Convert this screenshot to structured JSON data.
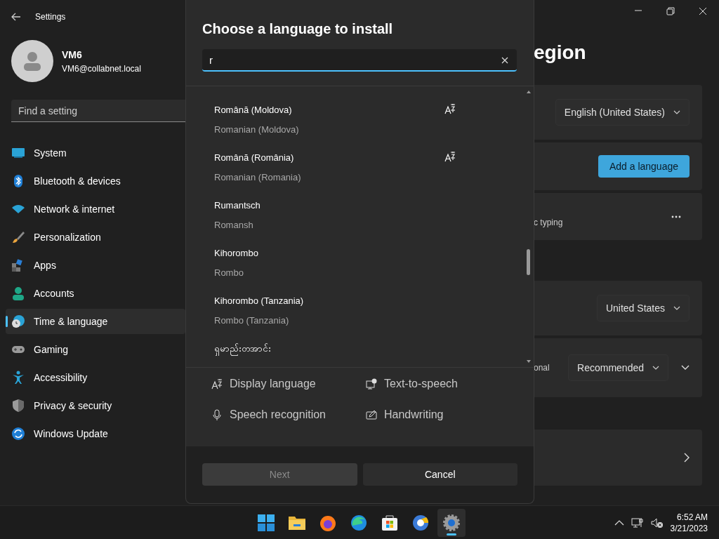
{
  "window": {
    "title": "Settings"
  },
  "profile": {
    "name": "VM6",
    "email": "VM6@collabnet.local"
  },
  "search": {
    "placeholder": "Find a setting"
  },
  "nav": [
    {
      "label": "System",
      "selected": false
    },
    {
      "label": "Bluetooth & devices",
      "selected": false
    },
    {
      "label": "Network & internet",
      "selected": false
    },
    {
      "label": "Personalization",
      "selected": false
    },
    {
      "label": "Apps",
      "selected": false
    },
    {
      "label": "Accounts",
      "selected": false
    },
    {
      "label": "Time & language",
      "selected": true
    },
    {
      "label": "Gaming",
      "selected": false
    },
    {
      "label": "Accessibility",
      "selected": false
    },
    {
      "label": "Privacy & security",
      "selected": false
    },
    {
      "label": "Windows Update",
      "selected": false
    }
  ],
  "page": {
    "heading": "egion",
    "cards": [
      {
        "kind": "dropdown",
        "value": "English (United States)"
      },
      {
        "kind": "button",
        "label": "Add a language"
      },
      {
        "kind": "more",
        "text": "c typing"
      },
      {
        "kind": "dropdown",
        "value": "United States"
      },
      {
        "kind": "expand",
        "text": "onal",
        "value": "Recommended"
      },
      {
        "kind": "link"
      }
    ]
  },
  "dialog": {
    "title": "Choose a language to install",
    "search": {
      "value": "r"
    },
    "languages": [
      {
        "native": "Română (Moldova)",
        "english": "Romanian (Moldova)",
        "display_language": true
      },
      {
        "native": "Română (România)",
        "english": "Romanian (Romania)",
        "display_language": true
      },
      {
        "native": "Rumantsch",
        "english": "Romansh",
        "display_language": false
      },
      {
        "native": "Kihorombo",
        "english": "Rombo",
        "display_language": false
      },
      {
        "native": "Kihorombo (Tanzania)",
        "english": "Rombo (Tanzania)",
        "display_language": false
      },
      {
        "native": "ရှမာည်းတအာင်း",
        "display_language": false
      }
    ],
    "features": [
      {
        "label": "Display language"
      },
      {
        "label": "Text-to-speech"
      },
      {
        "label": "Speech recognition"
      },
      {
        "label": "Handwriting"
      }
    ],
    "buttons": [
      {
        "label": "Next",
        "disabled": true
      },
      {
        "label": "Cancel",
        "disabled": false
      }
    ]
  },
  "taskbar": {
    "apps": [
      {
        "selected": false
      },
      {
        "selected": false
      },
      {
        "selected": false
      },
      {
        "selected": false
      },
      {
        "selected": false
      },
      {
        "selected": false
      },
      {
        "selected": true
      }
    ],
    "time": "6:52 AM",
    "date": "3/21/2023"
  }
}
